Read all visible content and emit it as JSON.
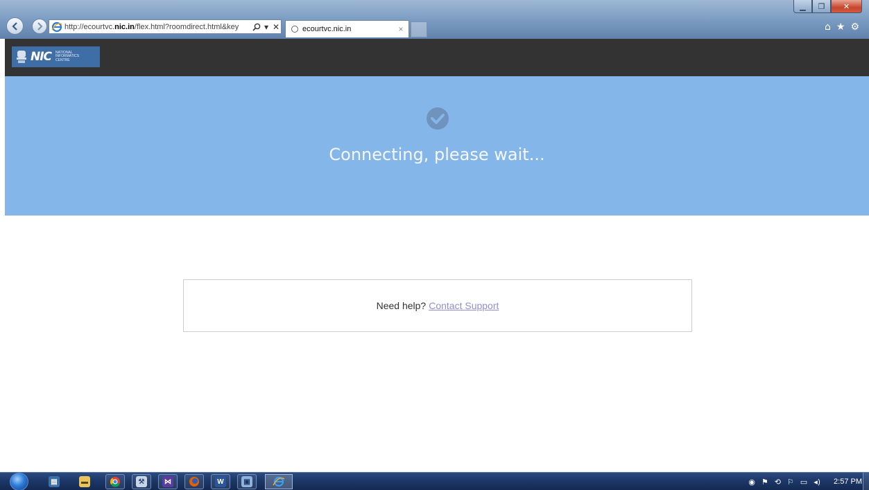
{
  "browser": {
    "url_prefix": "http://ecourtvc.",
    "url_domain": "nic.in",
    "url_suffix": "/flex.html?roomdirect.html&key",
    "tab_title": "ecourtvc.nic.in",
    "tab_close": "×"
  },
  "header": {
    "logo_text": "NIC",
    "logo_sub_1": "NATIONAL",
    "logo_sub_2": "INFORMATICS",
    "logo_sub_3": "CENTRE"
  },
  "banner": {
    "status": "Connecting, please wait...",
    "background": "#85b6e9"
  },
  "help": {
    "prompt": "Need help?",
    "link": "Contact Support"
  },
  "taskbar": {
    "clock": "2:57 PM",
    "apps": [
      "server-manager-icon",
      "file-explorer-icon",
      "chrome-icon",
      "tools-icon",
      "visual-studio-icon",
      "firefox-icon",
      "word-icon",
      "remote-desktop-icon",
      "internet-explorer-icon"
    ]
  }
}
